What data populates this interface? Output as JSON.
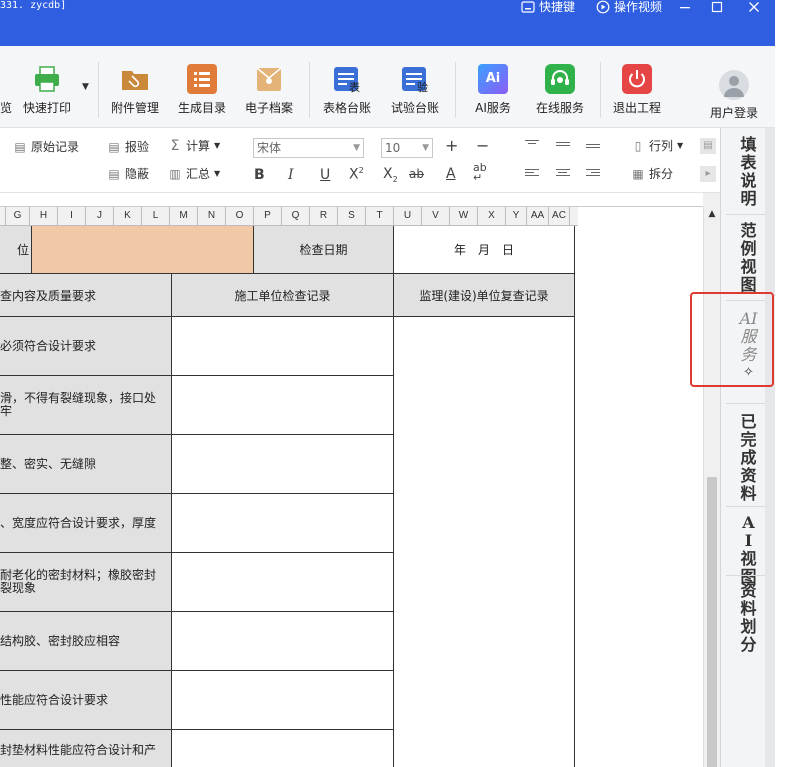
{
  "window": {
    "title_fragment": "331. zycdb]",
    "shortcut_label": "快捷键",
    "video_label": "操作视频"
  },
  "ribbon": {
    "partial_left_label": "览",
    "buttons": [
      {
        "label": "快速打印",
        "icon": "printer-icon",
        "color": "#3fae4a"
      },
      {
        "label": "附件管理",
        "icon": "paperclip-folder-icon",
        "color": "#c9883a"
      },
      {
        "label": "生成目录",
        "icon": "list-icon",
        "color": "#e07b39"
      },
      {
        "label": "电子档案",
        "icon": "archive-envelope-icon",
        "color": "#d9a35e"
      },
      {
        "label": "表格台账",
        "icon": "table-ledger-icon",
        "color": "#3a6fd8",
        "badge": "表"
      },
      {
        "label": "试验台账",
        "icon": "test-ledger-icon",
        "color": "#3a6fd8",
        "badge": "验"
      },
      {
        "label": "AI服务",
        "icon": "ai-icon",
        "color": "#6a5ce8",
        "badge": "Ai"
      },
      {
        "label": "在线服务",
        "icon": "headset-icon",
        "color": "#2fb24a"
      },
      {
        "label": "退出工程",
        "icon": "power-icon",
        "color": "#e54545"
      },
      {
        "label": "用户登录",
        "icon": "user-avatar-icon",
        "color": "#9aa0a8"
      }
    ]
  },
  "format_toolbar": {
    "original_record": "原始记录",
    "verify": "报验",
    "hide": "隐蔽",
    "calculate": "计算",
    "summary": "汇总",
    "font_name": "宋体",
    "font_size": "10",
    "row_col": "行列",
    "split": "拆分"
  },
  "columns": [
    "G",
    "H",
    "I",
    "J",
    "K",
    "L",
    "M",
    "N",
    "O",
    "P",
    "Q",
    "R",
    "S",
    "T",
    "U",
    "V",
    "W",
    "X",
    "Y",
    "AA",
    "AC"
  ],
  "sheet": {
    "row1_label_partial": "位",
    "check_date_label": "检查日期",
    "date_value": "年　月　日",
    "header_left_partial": "查内容及质量要求",
    "header_construction": "施工单位检查记录",
    "header_supervision": "监理(建设)单位复查记录",
    "items": [
      "必须符合设计要求",
      "滑，不得有裂缝现象，接口处\n牢",
      "整、密实、无缝隙",
      "、宽度应符合设计要求，厚度",
      "耐老化的密封材料；橡胶密封\n裂现象",
      "结构胶、密封胶应相容",
      "性能应符合设计要求",
      "封垫材料性能应符合设计和产"
    ]
  },
  "side_panel": {
    "tabs": [
      {
        "label": "填表说明"
      },
      {
        "label": "范例视图"
      },
      {
        "label": "AI服务"
      },
      {
        "label": "已完成资料"
      },
      {
        "label": "AI视图"
      },
      {
        "label": "资料划分"
      }
    ]
  },
  "colors": {
    "titlebar": "#2f5fe0",
    "highlight": "#e0392f",
    "cell_gray": "#e1e1e1",
    "cell_peach": "#f2c9a6"
  }
}
